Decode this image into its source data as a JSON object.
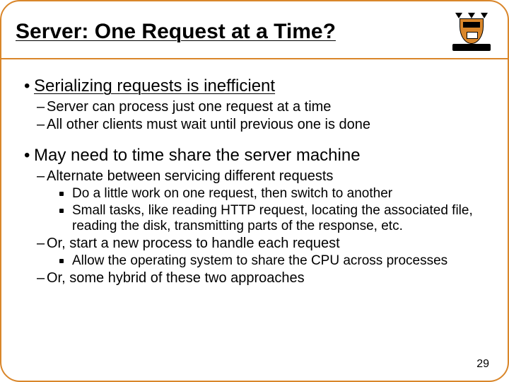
{
  "title": "Server: One Request at a Time?",
  "bullets": {
    "p1": "Serializing requests is inefficient",
    "p1a": "Server can process just one request at a time",
    "p1b": "All other clients must wait until previous one is done",
    "p2": "May need to time share the server machine",
    "p2a": "Alternate between servicing different requests",
    "p2a1": "Do a little work on one request, then switch to another",
    "p2a2": "Small tasks, like reading HTTP request, locating the associated file, reading the disk, transmitting parts of the response, etc.",
    "p2b": "Or, start a new process to handle each request",
    "p2b1": "Allow the operating system to share the CPU across processes",
    "p2c": "Or, some hybrid of these two approaches"
  },
  "page_number": "29"
}
